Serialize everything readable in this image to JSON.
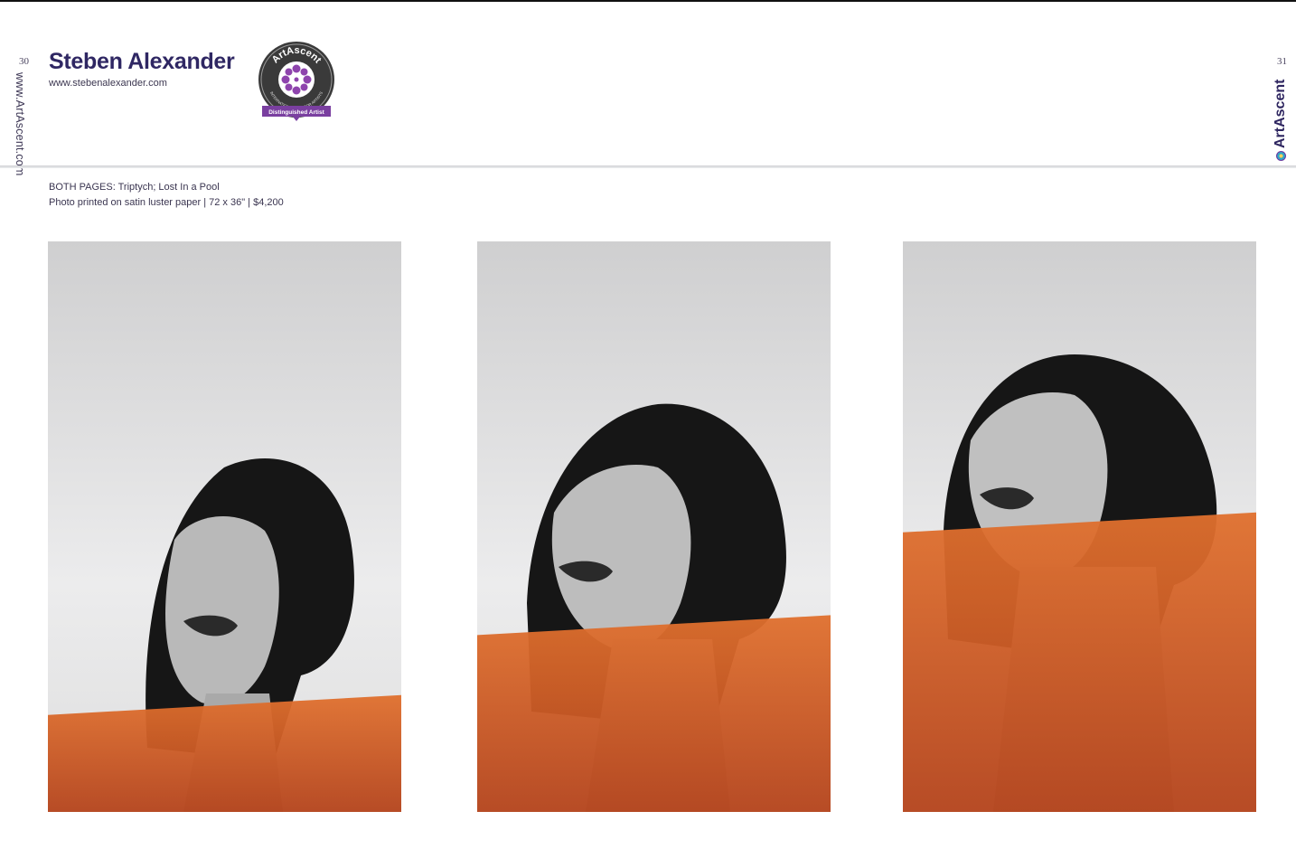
{
  "page": {
    "left_number": "30",
    "right_number": "31",
    "side_url": "www.ArtAscent.com",
    "side_brand": "ArtAscent"
  },
  "artist": {
    "name": "Steben Alexander",
    "website": "www.stebenalexander.com"
  },
  "badge": {
    "title": "ArtAscent",
    "ring_text": "INTERNATIONAL CALL FOR ARTISTS",
    "ribbon": "Distinguished Artist",
    "colors": {
      "dark": "#3a3a3a",
      "ribbon": "#7a3fa0",
      "star": "#8e44ad"
    }
  },
  "caption": {
    "line1": "BOTH PAGES: Triptych; Lost In a Pool",
    "line2": "Photo printed on satin luster paper | 72 x 36\" | $4,200"
  },
  "photos": [
    {
      "name": "photo-left",
      "water_level": 0.17
    },
    {
      "name": "photo-center",
      "water_level": 0.31
    },
    {
      "name": "photo-right",
      "water_level": 0.49
    }
  ],
  "colors": {
    "name": "#2f2763",
    "orange": "#d8652a",
    "background_grey": "#dcdcdd"
  }
}
